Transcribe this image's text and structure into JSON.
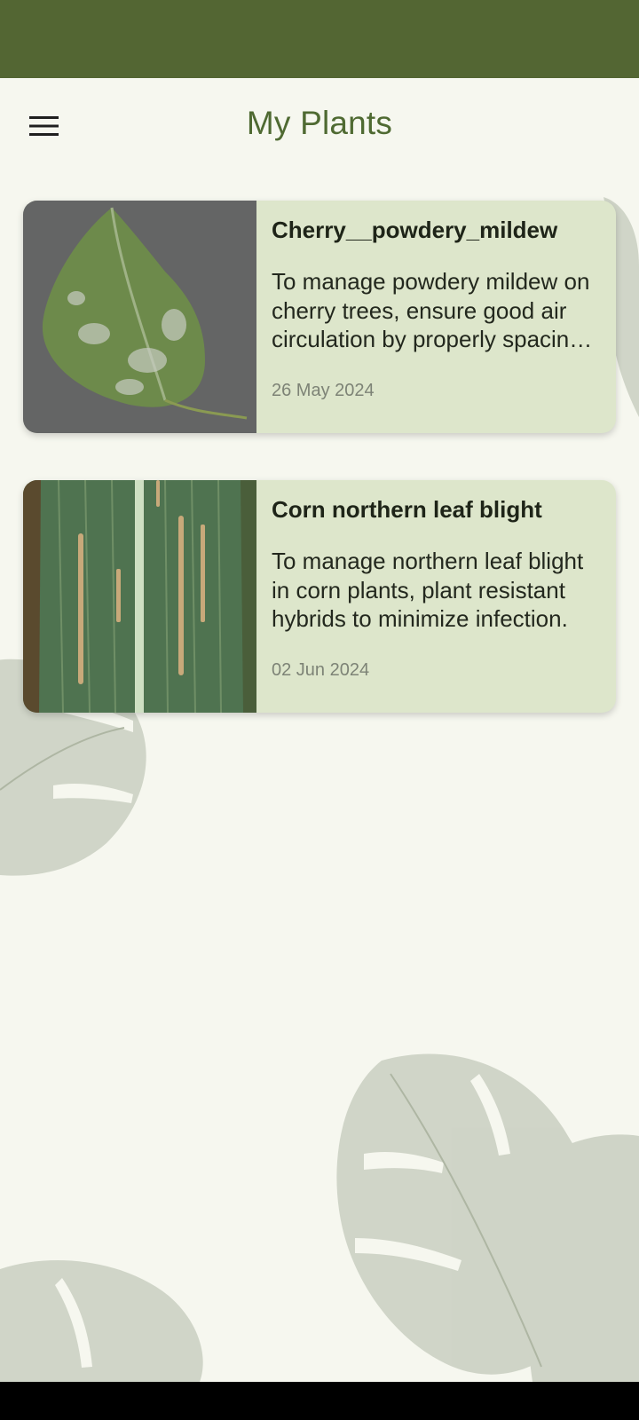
{
  "app_bar": {
    "title": "My Plants",
    "menu_icon": "hamburger-menu-icon"
  },
  "colors": {
    "status_bar": "#536633",
    "background": "#f6f7ef",
    "title": "#4f6a32",
    "card_background": "#dde6cb"
  },
  "plants": [
    {
      "name": "Cherry__powdery_mildew",
      "description": "To manage powdery mildew on cherry trees, ensure good air circulation by properly spacing and pruning the trees.",
      "date": "26 May 2024",
      "image": "cherry-leaf-powdery-mildew-photo"
    },
    {
      "name": "Corn northern leaf blight",
      "description": "To manage northern leaf blight in corn plants, plant resistant hybrids to minimize infection.",
      "date": "02 Jun 2024",
      "image": "corn-leaf-blight-photo"
    }
  ]
}
